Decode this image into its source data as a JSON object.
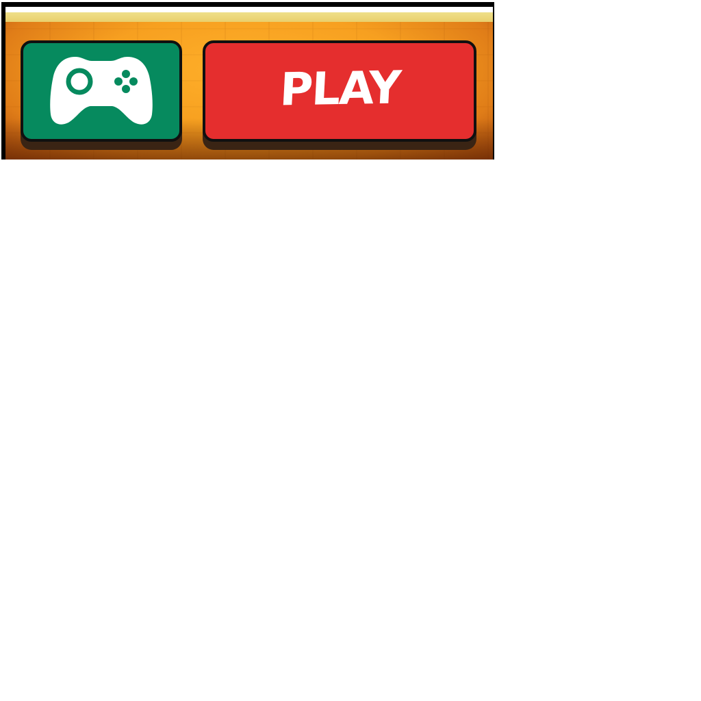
{
  "colors": {
    "frame": "#000000",
    "background_orange": "#f7a020",
    "gold_strip": "#e9cf6c",
    "gamepad_button_green": "#068a5e",
    "play_button_red": "#e52e2e",
    "button_border": "#101010",
    "label_white": "#ffffff"
  },
  "buttons": {
    "gamepad": {
      "icon": "gamepad-icon"
    },
    "play": {
      "label": "PLAY"
    }
  }
}
